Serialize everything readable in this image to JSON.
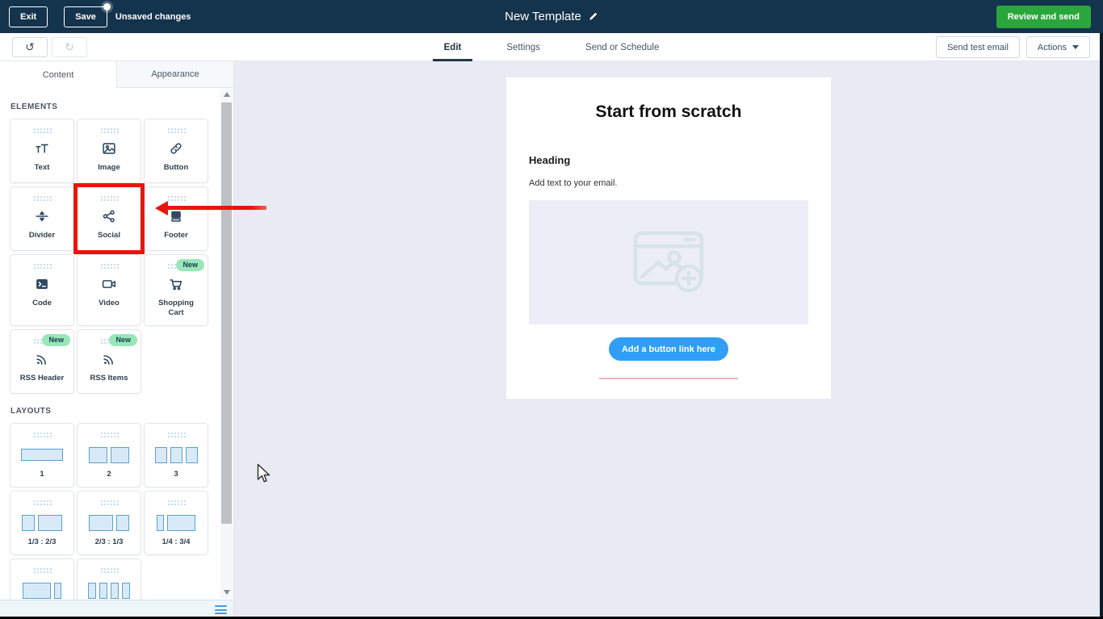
{
  "topbar": {
    "exit": "Exit",
    "save": "Save",
    "unsaved": "Unsaved changes",
    "title": "New Template",
    "review": "Review and send",
    "colors": {
      "bg": "#14334c",
      "review_green": "#2ba63c"
    }
  },
  "toolbar": {
    "tabs": [
      {
        "label": "Edit"
      },
      {
        "label": "Settings"
      },
      {
        "label": "Send or Schedule"
      }
    ],
    "active_tab": "Edit",
    "send_test": "Send test email",
    "actions": "Actions"
  },
  "sidebar": {
    "tabs": [
      {
        "label": "Content"
      },
      {
        "label": "Appearance"
      }
    ],
    "active_tab": "Content",
    "sections": {
      "elements": "ELEMENTS",
      "layouts": "LAYOUTS"
    },
    "elements": [
      {
        "label": "Text",
        "icon": "text-icon"
      },
      {
        "label": "Image",
        "icon": "image-icon"
      },
      {
        "label": "Button",
        "icon": "link-icon"
      },
      {
        "label": "Divider",
        "icon": "divider-icon"
      },
      {
        "label": "Social",
        "icon": "share-icon",
        "highlighted": true
      },
      {
        "label": "Footer",
        "icon": "footer-icon"
      },
      {
        "label": "Code",
        "icon": "code-icon"
      },
      {
        "label": "Video",
        "icon": "video-icon"
      },
      {
        "label": "Shopping Cart",
        "icon": "cart-icon",
        "badge": "New"
      },
      {
        "label": "RSS Header",
        "icon": "rss-icon",
        "badge": "New"
      },
      {
        "label": "RSS Items",
        "icon": "rss-icon",
        "badge": "New"
      }
    ],
    "layouts": [
      {
        "label": "1"
      },
      {
        "label": "2"
      },
      {
        "label": "3"
      },
      {
        "label": "1/3 : 2/3"
      },
      {
        "label": "2/3 : 1/3"
      },
      {
        "label": "1/4 : 3/4"
      }
    ],
    "badge_color": "#99e6b9"
  },
  "canvas": {
    "title": "Start from scratch",
    "heading": "Heading",
    "body": "Add text to your email.",
    "button": "Add a button link here",
    "button_color": "#2f9ef4",
    "divider_color": "#f0b6ba"
  },
  "annotation": {
    "highlight_color": "#e8150d"
  }
}
